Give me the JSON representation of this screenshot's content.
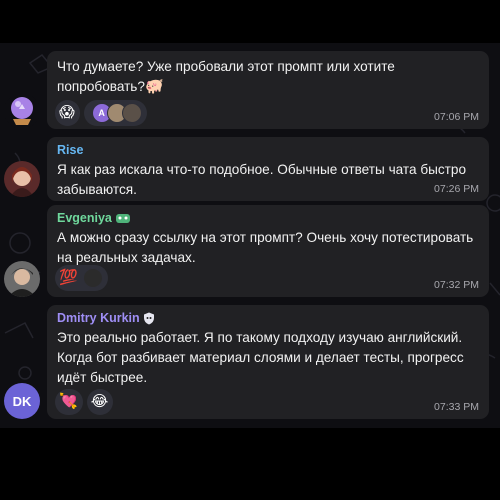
{
  "messages": [
    {
      "text": "Что думаете? Уже пробовали этот промпт или хотите попробовать?",
      "inline_emoji": "🐖",
      "time": "07:06 PM",
      "reactions": [
        {
          "emoji": "😱"
        },
        {
          "avatars": [
            "A",
            "",
            ""
          ]
        }
      ]
    },
    {
      "sender": "Rise",
      "sender_color": "#66b7f2",
      "text": "Я как раз искала что-то подобное. Обычные ответы чата быстро забываются.",
      "time": "07:26 PM"
    },
    {
      "sender": "Evgeniya",
      "sender_color": "#6fd89c",
      "text": "А можно сразу ссылку на этот промпт? Очень хочу потестировать на реальных задачах.",
      "time": "07:32 PM",
      "reactions": [
        {
          "emoji": "💯"
        }
      ]
    },
    {
      "sender": "Dmitry Kurkin",
      "sender_color": "#9f8ef5",
      "text": "Это реально работает. Я по такому подходу изучаю английский. Когда бот разбивает материал слоями и делает тесты, прогресс идёт быстрее.",
      "time": "07:33 PM",
      "avatar_initials": "DK",
      "reactions": [
        {
          "emoji": "💘"
        },
        {
          "emoji": "😂"
        }
      ]
    }
  ],
  "colors": {
    "background": "#0e0e12",
    "bubble": "#212124",
    "reaction": "#2e2f38",
    "time": "#a7a7ad",
    "dk_avatar": "#6b63d6"
  }
}
